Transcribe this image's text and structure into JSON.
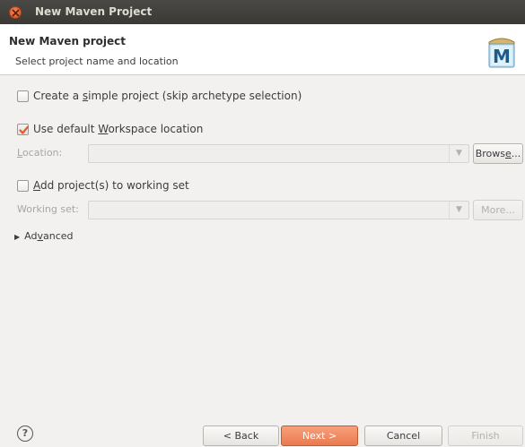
{
  "window": {
    "title": "New Maven Project"
  },
  "header": {
    "title": "New Maven project",
    "subtitle": "Select project name and location",
    "icon": "maven-m-icon",
    "icon_letter": "M"
  },
  "options": {
    "simple_project": {
      "label_pre": "Create a ",
      "label_mn": "s",
      "label_post": "imple project (skip archetype selection)",
      "checked": false
    },
    "default_workspace": {
      "label_pre": "Use default ",
      "label_mn": "W",
      "label_post": "orkspace location",
      "checked": true
    },
    "location": {
      "label_mn": "L",
      "label_post": "ocation:",
      "value": "",
      "browse_pre": "Brows",
      "browse_mn": "e",
      "browse_post": "..."
    },
    "working_set_add": {
      "label_mn": "A",
      "label_post": "dd project(s) to working set",
      "checked": false
    },
    "working_set": {
      "label": "Working set:",
      "value": "",
      "more_label": "More..."
    },
    "advanced": {
      "label_pre": "Ad",
      "label_mn": "v",
      "label_post": "anced"
    }
  },
  "footer": {
    "help": "?",
    "back": "< Back",
    "next": "Next >",
    "cancel": "Cancel",
    "finish": "Finish"
  },
  "colors": {
    "accent": "#ea7a50",
    "titlebar": "#3c3b37",
    "background": "#f2f1f0"
  }
}
